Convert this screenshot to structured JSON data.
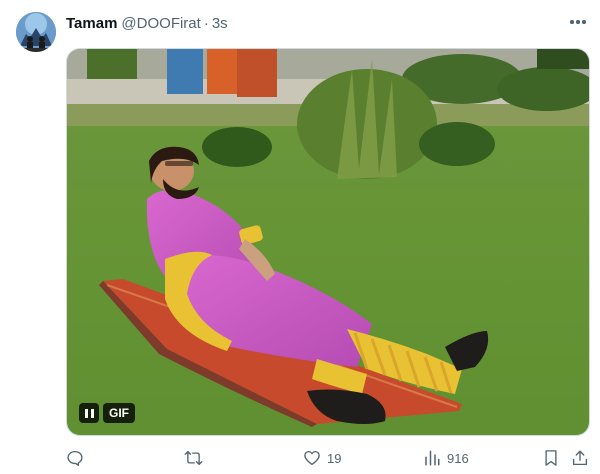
{
  "author": {
    "display_name": "Tamam",
    "handle": "@DOOFirat",
    "separator": "·",
    "timestamp": "3s",
    "avatar_icon": "profile-avatar"
  },
  "header": {
    "more_icon": "more-horizontal-icon"
  },
  "media": {
    "type": "gif",
    "badge_label": "GIF",
    "pause_icon": "pause-icon"
  },
  "actions": {
    "reply_icon": "reply-icon",
    "reply_count": "",
    "retweet_icon": "retweet-icon",
    "retweet_count": "",
    "like_icon": "heart-icon",
    "like_count": "19",
    "views_icon": "views-bar-chart-icon",
    "views_count": "916",
    "bookmark_icon": "bookmark-icon",
    "share_icon": "share-icon"
  },
  "colors": {
    "secondary_text": "#536471",
    "primary_text": "#0f1419",
    "border": "#cfd9de"
  }
}
